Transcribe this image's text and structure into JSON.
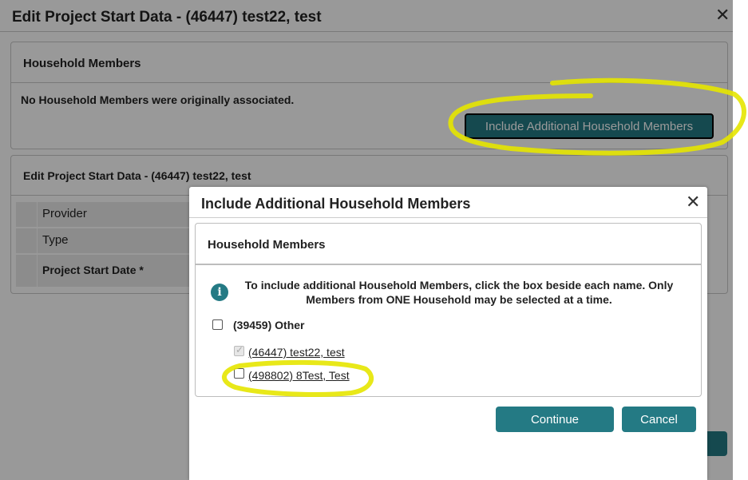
{
  "background_dialog": {
    "title": "Edit Project Start Data - (46447) test22, test",
    "close_glyph": "✕",
    "household_panel": {
      "title": "Household Members",
      "message": "No Household Members were originally associated.",
      "include_button": "Include Additional Household Members"
    },
    "edit_panel": {
      "title": "Edit Project Start Data - (46447) test22, test",
      "rows": [
        "Provider",
        "Type",
        "Project Start Date *"
      ]
    }
  },
  "modal": {
    "title": "Include Additional Household Members",
    "close_glyph": "✕",
    "panel_title": "Household Members",
    "info_icon": "i",
    "instructions": "To include additional Household Members, click the box beside each name. Only Members from ONE Household may be selected at a time.",
    "household_group": "(39459) Other",
    "members": [
      {
        "label": "(46447) test22, test",
        "checked": true,
        "disabled": true
      },
      {
        "label": "(498802) 8Test, Test",
        "checked": false,
        "disabled": false
      }
    ],
    "continue_button": "Continue",
    "cancel_button": "Cancel"
  },
  "colors": {
    "accent": "#247a84",
    "highlight": "#e6e600"
  }
}
